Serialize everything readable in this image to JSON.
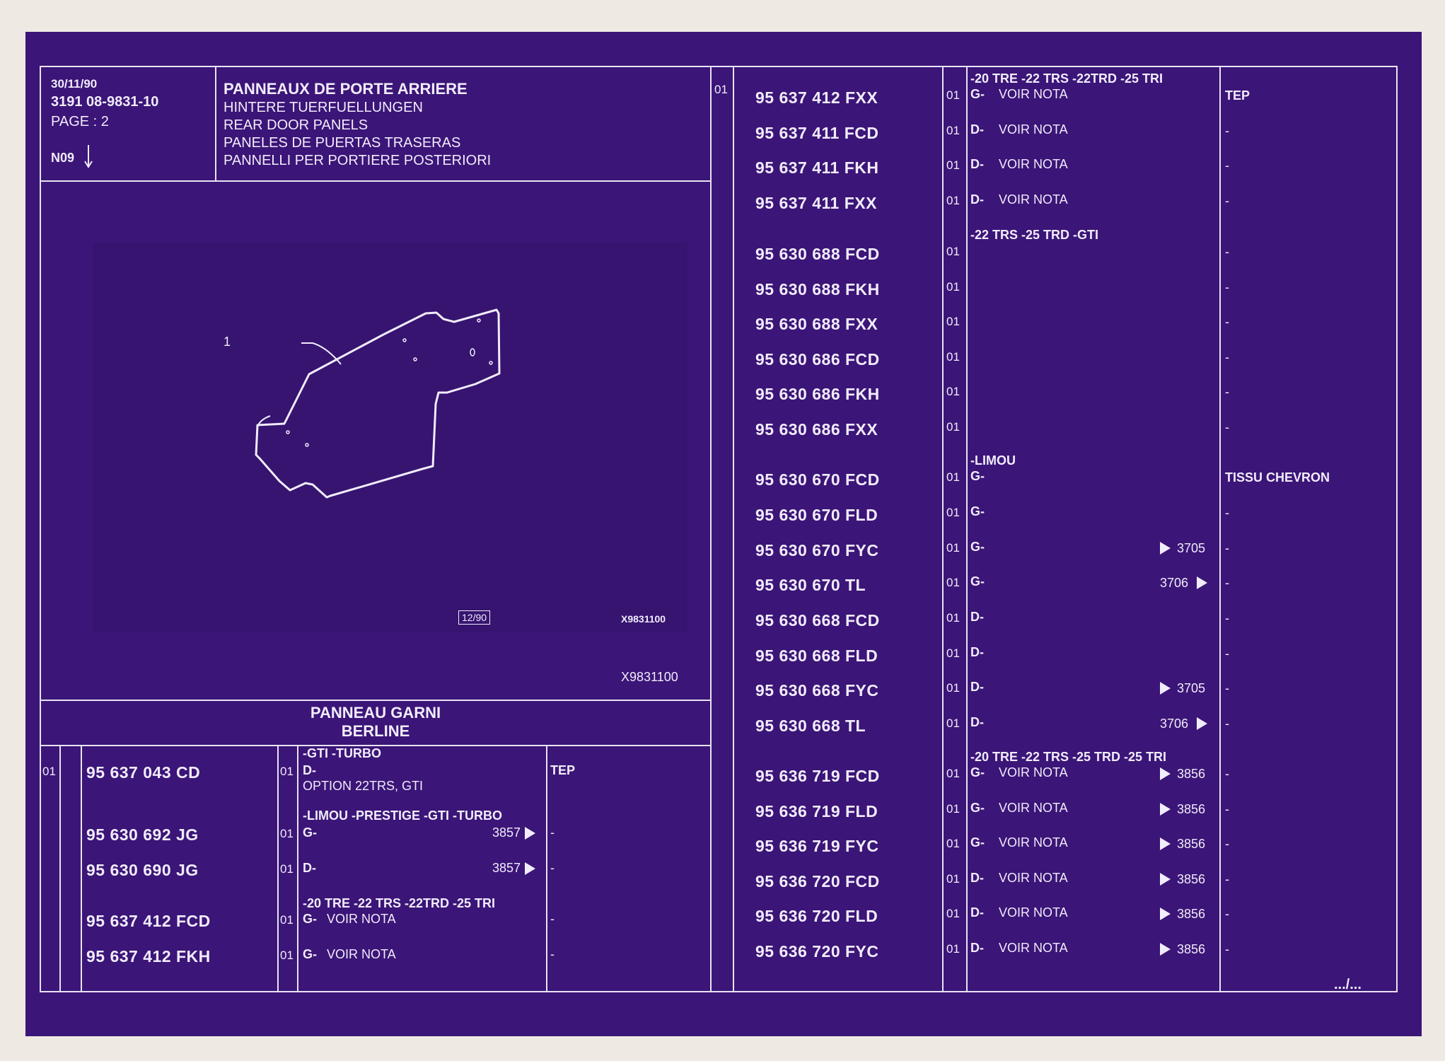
{
  "header": {
    "date": "30/11/90",
    "ref": "3191  08-9831-10",
    "page": "PAGE : 2",
    "code": "N09",
    "arrow_icon": "down-arrow-icon",
    "titles": [
      "PANNEAUX DE PORTE ARRIERE",
      "HINTERE TUERFUELLUNGEN",
      "REAR DOOR PANELS",
      "PANELES DE PUERTAS TRASERAS",
      "PANNELLI PER PORTIERE POSTERIORI"
    ]
  },
  "drawing": {
    "callout": "1",
    "stamp": "12/90",
    "code_inner": "X9831100",
    "code_outer": "X9831100"
  },
  "section": {
    "title1": "PANNEAU GARNI",
    "title2": "BERLINE"
  },
  "left_table": {
    "ref_col": "01",
    "rows": [
      {
        "heading": "-GTI -TURBO",
        "part": "95 637 043 CD",
        "qty": "01",
        "side": "D-",
        "note": "",
        "ref": "",
        "remark": "TEP",
        "extra": "OPTION 22TRS, GTI"
      },
      {
        "heading": "-LIMOU -PRESTIGE -GTI -TURBO",
        "part": "95 630 692 JG",
        "qty": "01",
        "side": "G-",
        "note": "",
        "ref": "3857",
        "remark": "-"
      },
      {
        "heading": "",
        "part": "95 630 690 JG",
        "qty": "01",
        "side": "D-",
        "note": "",
        "ref": "3857",
        "remark": "-"
      },
      {
        "heading": "-20 TRE -22 TRS -22TRD -25 TRI",
        "part": "95 637 412 FCD",
        "qty": "01",
        "side": "G-",
        "note": "VOIR NOTA",
        "ref": "",
        "remark": "-"
      },
      {
        "heading": "",
        "part": "95 637 412 FKH",
        "qty": "01",
        "side": "G-",
        "note": "VOIR NOTA",
        "ref": "",
        "remark": "-"
      }
    ]
  },
  "right_table": {
    "ref_col": "01",
    "rows": [
      {
        "heading": "-20 TRE -22 TRS -22TRD -25 TRI",
        "part": "95 637 412 FXX",
        "qty": "01",
        "side": "G-",
        "note": "VOIR NOTA",
        "ref": "",
        "remark": "TEP"
      },
      {
        "heading": "",
        "part": "95 637 411 FCD",
        "qty": "01",
        "side": "D-",
        "note": "VOIR NOTA",
        "ref": "",
        "remark": "-"
      },
      {
        "heading": "",
        "part": "95 637 411 FKH",
        "qty": "01",
        "side": "D-",
        "note": "VOIR NOTA",
        "ref": "",
        "remark": "-"
      },
      {
        "heading": "",
        "part": "95 637 411 FXX",
        "qty": "01",
        "side": "D-",
        "note": "VOIR NOTA",
        "ref": "",
        "remark": "-"
      },
      {
        "heading": "-22 TRS -25 TRD -GTI",
        "part": "95 630 688 FCD",
        "qty": "01",
        "side": "",
        "note": "",
        "ref": "",
        "remark": "-"
      },
      {
        "heading": "",
        "part": "95 630 688 FKH",
        "qty": "01",
        "side": "",
        "note": "",
        "ref": "",
        "remark": "-"
      },
      {
        "heading": "",
        "part": "95 630 688 FXX",
        "qty": "01",
        "side": "",
        "note": "",
        "ref": "",
        "remark": "-"
      },
      {
        "heading": "",
        "part": "95 630 686 FCD",
        "qty": "01",
        "side": "",
        "note": "",
        "ref": "",
        "remark": "-"
      },
      {
        "heading": "",
        "part": "95 630 686 FKH",
        "qty": "01",
        "side": "",
        "note": "",
        "ref": "",
        "remark": "-"
      },
      {
        "heading": "",
        "part": "95 630 686 FXX",
        "qty": "01",
        "side": "",
        "note": "",
        "ref": "",
        "remark": "-"
      },
      {
        "heading": "-LIMOU",
        "part": "95 630 670 FCD",
        "qty": "01",
        "side": "G-",
        "note": "",
        "ref": "",
        "remark": "TISSU CHEVRON"
      },
      {
        "heading": "",
        "part": "95 630 670 FLD",
        "qty": "01",
        "side": "G-",
        "note": "",
        "ref": "",
        "remark": "-"
      },
      {
        "heading": "",
        "part": "95 630 670 FYC",
        "qty": "01",
        "side": "G-",
        "note": "",
        "ref": "3705",
        "remark": "-"
      },
      {
        "heading": "",
        "part": "95 630 670 TL",
        "qty": "01",
        "side": "G-",
        "note": "",
        "ref": "3706",
        "remark": "-"
      },
      {
        "heading": "",
        "part": "95 630 668 FCD",
        "qty": "01",
        "side": "D-",
        "note": "",
        "ref": "",
        "remark": "-"
      },
      {
        "heading": "",
        "part": "95 630 668 FLD",
        "qty": "01",
        "side": "D-",
        "note": "",
        "ref": "",
        "remark": "-"
      },
      {
        "heading": "",
        "part": "95 630 668 FYC",
        "qty": "01",
        "side": "D-",
        "note": "",
        "ref": "3705",
        "remark": "-"
      },
      {
        "heading": "",
        "part": "95 630 668 TL",
        "qty": "01",
        "side": "D-",
        "note": "",
        "ref": "3706",
        "remark": "-"
      },
      {
        "heading": "-20 TRE -22 TRS -25 TRD -25 TRI",
        "part": "95 636 719 FCD",
        "qty": "01",
        "side": "G-",
        "note": "VOIR NOTA",
        "ref": "3856",
        "remark": "-"
      },
      {
        "heading": "",
        "part": "95 636 719 FLD",
        "qty": "01",
        "side": "G-",
        "note": "VOIR NOTA",
        "ref": "3856",
        "remark": "-"
      },
      {
        "heading": "",
        "part": "95 636 719 FYC",
        "qty": "01",
        "side": "G-",
        "note": "VOIR NOTA",
        "ref": "3856",
        "remark": "-"
      },
      {
        "heading": "",
        "part": "95 636 720 FCD",
        "qty": "01",
        "side": "D-",
        "note": "VOIR NOTA",
        "ref": "3856",
        "remark": "-"
      },
      {
        "heading": "",
        "part": "95 636 720 FLD",
        "qty": "01",
        "side": "D-",
        "note": "VOIR NOTA",
        "ref": "3856",
        "remark": "-"
      },
      {
        "heading": "",
        "part": "95 636 720 FYC",
        "qty": "01",
        "side": "D-",
        "note": "VOIR NOTA",
        "ref": "3856",
        "remark": "-"
      }
    ]
  },
  "footer": {
    "continued": ".../..."
  },
  "colors": {
    "sheet": "#3b1577",
    "ink": "#f1ecfb",
    "paper": "#efe9e4"
  }
}
